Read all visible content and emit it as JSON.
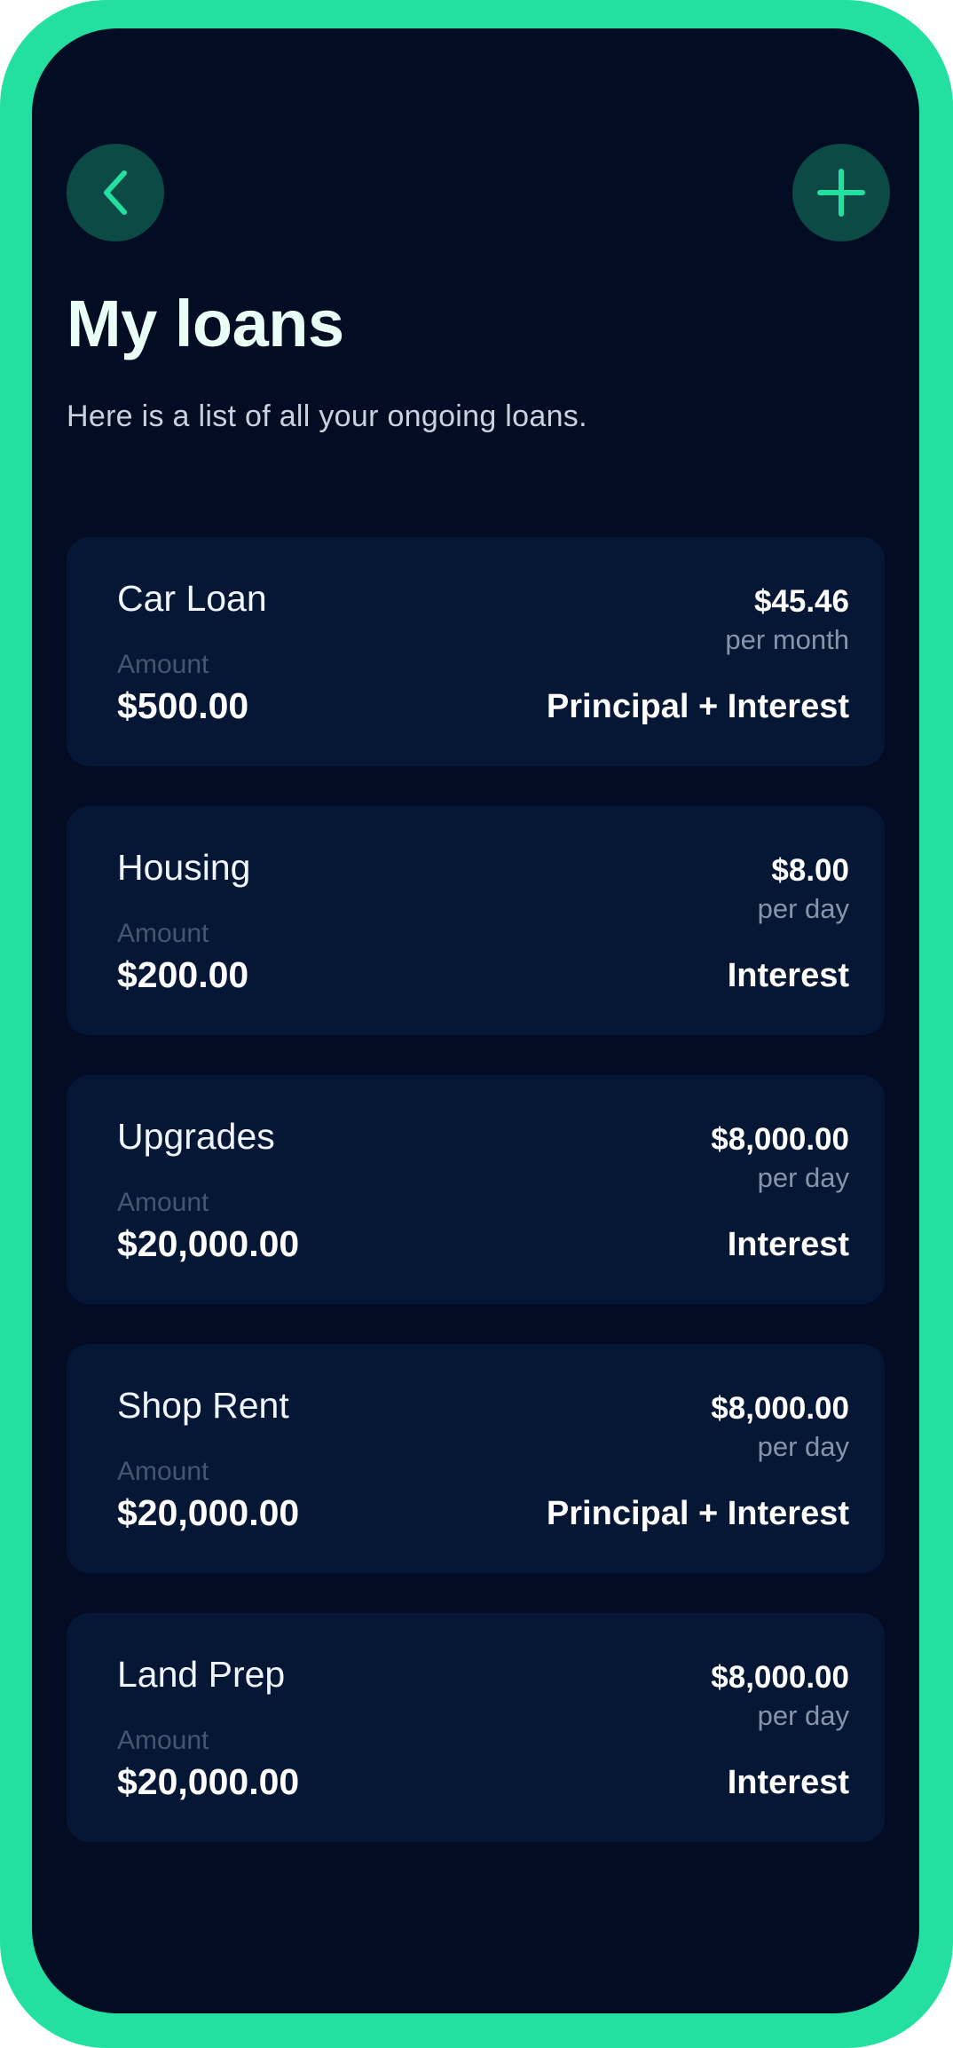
{
  "header": {
    "title": "My loans",
    "subtitle": "Here is a list of all your ongoing loans."
  },
  "icons": {
    "back": "chevron-left-icon",
    "add": "plus-icon"
  },
  "colors": {
    "accent": "#23e0a0",
    "background": "#020d24",
    "card": "#061736",
    "icon_button": "#0c4a46"
  },
  "loans": [
    {
      "name": "Car Loan",
      "amount_label": "Amount",
      "amount": "$500.00",
      "rate": "$45.46",
      "period": "per month",
      "type": "Principal + Interest"
    },
    {
      "name": "Housing",
      "amount_label": "Amount",
      "amount": "$200.00",
      "rate": "$8.00",
      "period": "per day",
      "type": "Interest"
    },
    {
      "name": "Upgrades",
      "amount_label": "Amount",
      "amount": "$20,000.00",
      "rate": "$8,000.00",
      "period": "per day",
      "type": "Interest"
    },
    {
      "name": "Shop Rent",
      "amount_label": "Amount",
      "amount": "$20,000.00",
      "rate": "$8,000.00",
      "period": "per day",
      "type": "Principal + Interest"
    },
    {
      "name": "Land Prep",
      "amount_label": "Amount",
      "amount": "$20,000.00",
      "rate": "$8,000.00",
      "period": "per day",
      "type": "Interest"
    }
  ]
}
